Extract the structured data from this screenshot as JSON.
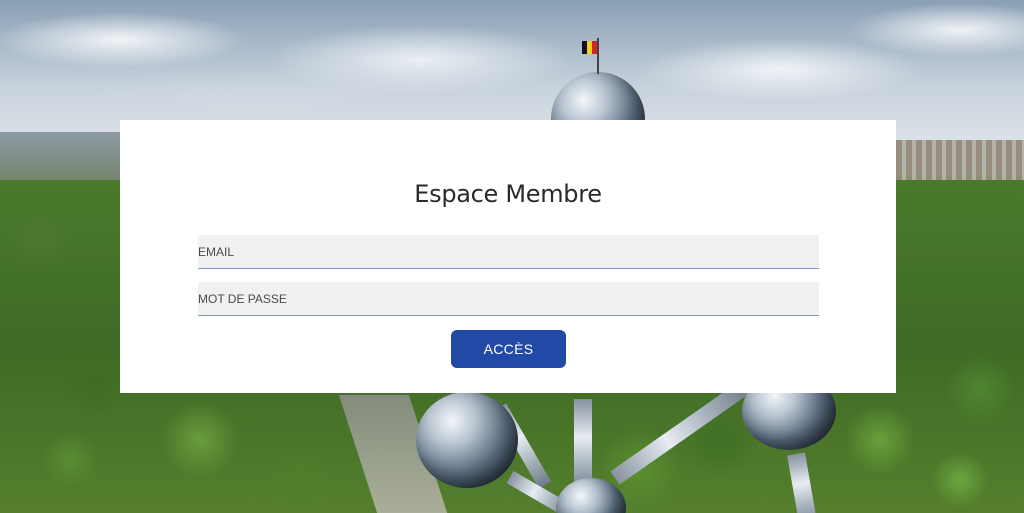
{
  "login": {
    "title": "Espace Membre",
    "email_placeholder": "EMAIL",
    "password_placeholder": "MOT DE PASSE",
    "submit_label": "ACCÈS"
  },
  "background": {
    "flag_colors": [
      "#111111",
      "#f2cf1f",
      "#d2232a"
    ]
  },
  "colors": {
    "button": "#2149a6",
    "field_bg": "#f1f1f1",
    "field_underline": "#7f97c9"
  }
}
